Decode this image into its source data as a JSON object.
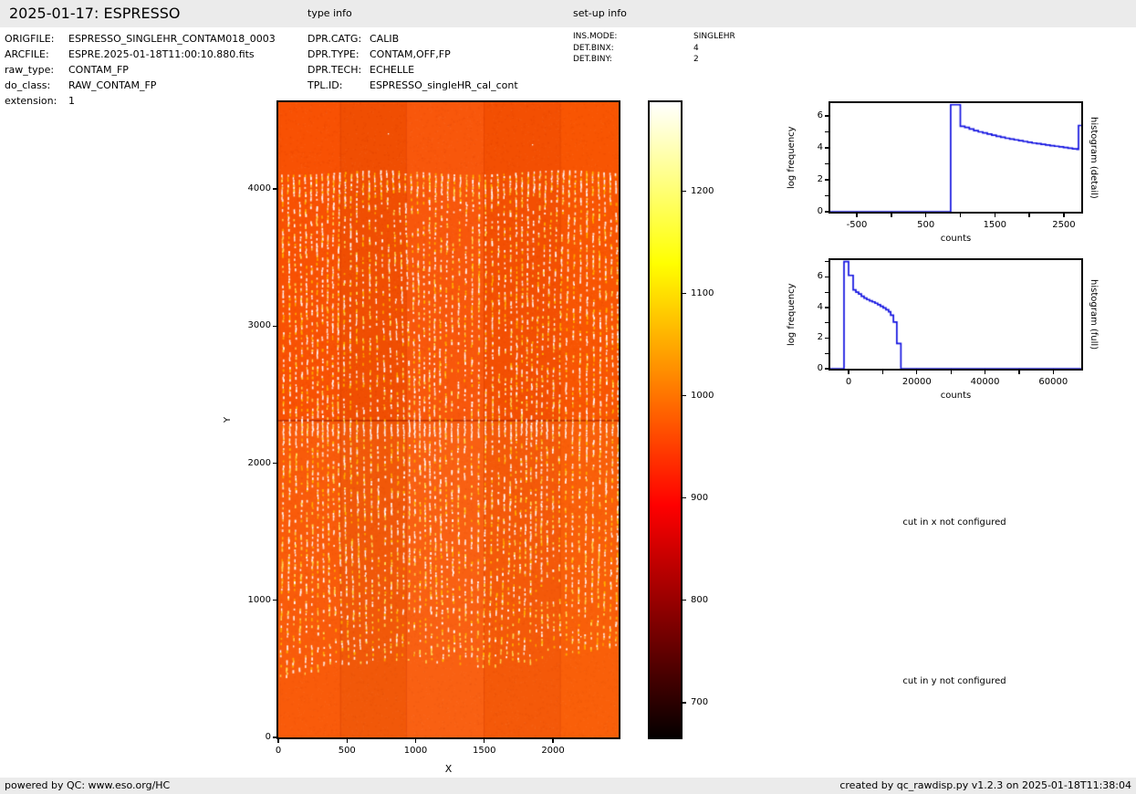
{
  "header": {
    "title": "2025-01-17: ESPRESSO",
    "type_info_label": "type info",
    "setup_info_label": "set-up info"
  },
  "file_info": {
    "rows": [
      {
        "label": "ORIGFILE:",
        "value": "ESPRESSO_SINGLEHR_CONTAM018_0003"
      },
      {
        "label": "ARCFILE:",
        "value": "ESPRE.2025-01-18T11:00:10.880.fits"
      },
      {
        "label": "raw_type:",
        "value": "CONTAM_FP"
      },
      {
        "label": "do_class:",
        "value": "RAW_CONTAM_FP"
      },
      {
        "label": "extension:",
        "value": "1"
      }
    ]
  },
  "type_info": {
    "rows": [
      {
        "label": "DPR.CATG:",
        "value": "CALIB"
      },
      {
        "label": "DPR.TYPE:",
        "value": "CONTAM,OFF,FP"
      },
      {
        "label": "DPR.TECH:",
        "value": "ECHELLE"
      },
      {
        "label": "TPL.ID:",
        "value": "ESPRESSO_singleHR_cal_cont"
      }
    ]
  },
  "setup_info": {
    "rows": [
      {
        "label": "INS.MODE:",
        "value": "SINGLEHR"
      },
      {
        "label": "DET.BINX:",
        "value": "4"
      },
      {
        "label": "DET.BINY:",
        "value": "2"
      }
    ]
  },
  "messages": {
    "cut_x": "cut in x not configured",
    "cut_y": "cut in y not configured"
  },
  "footer": {
    "left": "powered by QC: www.eso.org/HC",
    "right": "created by qc_rawdisp.py v1.2.3 on 2025-01-18T11:38:04"
  },
  "chart_data": [
    {
      "id": "detector_image",
      "type": "heatmap",
      "xlabel": "X",
      "ylabel": "Y",
      "xlim": [
        0,
        2478
      ],
      "ylim": [
        0,
        4633
      ],
      "xticks": [
        0,
        500,
        1000,
        1500,
        2000
      ],
      "yticks": [
        0,
        1000,
        2000,
        3000,
        4000
      ],
      "colormap": "hot",
      "colorbar": {
        "vmin": 666,
        "vmax": 1287,
        "ticks": [
          700,
          800,
          900,
          1000,
          1100,
          1200
        ]
      },
      "appearance": {
        "background_counts": 1000,
        "base_color": "#f85103",
        "lower_half_lighten": "rgba(255,166,60,0.13)",
        "stripe_colors": [
          "#ffffff",
          "#ffe05a",
          "#ffb300"
        ],
        "stripe_count": 57,
        "stripe_region_y": [
          520,
          4120
        ],
        "detector_gap_y": 2310,
        "amp_column_boundaries_x": [
          450,
          930,
          1495,
          2050
        ]
      }
    },
    {
      "id": "histogram_detail",
      "type": "line",
      "xlabel": "counts",
      "ylabel": "log frequency",
      "right_label": "histogram (detail)",
      "line_color": "#1414e0",
      "xlim": [
        -884,
        2752
      ],
      "ylim": [
        0,
        6.8
      ],
      "xticks_major": [
        -500,
        500,
        1500,
        2500
      ],
      "xticks_minor": [
        0,
        1000,
        2000
      ],
      "yticks_major": [
        0,
        2,
        4,
        6
      ],
      "yticks_minor": [
        1,
        3,
        5
      ],
      "steps": [
        [
          -884,
          0
        ],
        [
          860,
          6.7
        ],
        [
          1000,
          5.35
        ],
        [
          1065,
          5.28
        ],
        [
          1130,
          5.18
        ],
        [
          1195,
          5.08
        ],
        [
          1260,
          5.0
        ],
        [
          1325,
          4.93
        ],
        [
          1390,
          4.86
        ],
        [
          1455,
          4.79
        ],
        [
          1520,
          4.72
        ],
        [
          1585,
          4.66
        ],
        [
          1650,
          4.6
        ],
        [
          1715,
          4.55
        ],
        [
          1780,
          4.5
        ],
        [
          1845,
          4.45
        ],
        [
          1910,
          4.4
        ],
        [
          1975,
          4.35
        ],
        [
          2040,
          4.3
        ],
        [
          2105,
          4.26
        ],
        [
          2170,
          4.22
        ],
        [
          2235,
          4.18
        ],
        [
          2300,
          4.14
        ],
        [
          2365,
          4.1
        ],
        [
          2430,
          4.06
        ],
        [
          2495,
          4.02
        ],
        [
          2560,
          3.98
        ],
        [
          2625,
          3.94
        ],
        [
          2690,
          3.9
        ],
        [
          2712,
          5.4
        ]
      ]
    },
    {
      "id": "histogram_full",
      "type": "line",
      "xlabel": "counts",
      "ylabel": "log frequency",
      "right_label": "histogram (full)",
      "line_color": "#1414e0",
      "xlim": [
        -5350,
        68200
      ],
      "ylim": [
        0,
        7.1
      ],
      "xticks_major": [
        0,
        20000,
        40000,
        60000
      ],
      "xticks_minor": [
        10000,
        30000,
        50000
      ],
      "yticks_major": [
        0,
        2,
        4,
        6
      ],
      "yticks_minor": [
        1,
        3,
        5,
        7
      ],
      "steps": [
        [
          -5350,
          0
        ],
        [
          -1340,
          7.0
        ],
        [
          0,
          6.1
        ],
        [
          1340,
          5.15
        ],
        [
          2140,
          5.0
        ],
        [
          2940,
          4.88
        ],
        [
          3740,
          4.74
        ],
        [
          4540,
          4.62
        ],
        [
          5340,
          4.52
        ],
        [
          6140,
          4.44
        ],
        [
          6940,
          4.37
        ],
        [
          7740,
          4.28
        ],
        [
          8540,
          4.18
        ],
        [
          9340,
          4.08
        ],
        [
          10140,
          3.97
        ],
        [
          10940,
          3.85
        ],
        [
          11740,
          3.72
        ],
        [
          12340,
          3.5
        ],
        [
          13140,
          3.05
        ],
        [
          14140,
          1.65
        ],
        [
          15340,
          0
        ]
      ]
    }
  ]
}
